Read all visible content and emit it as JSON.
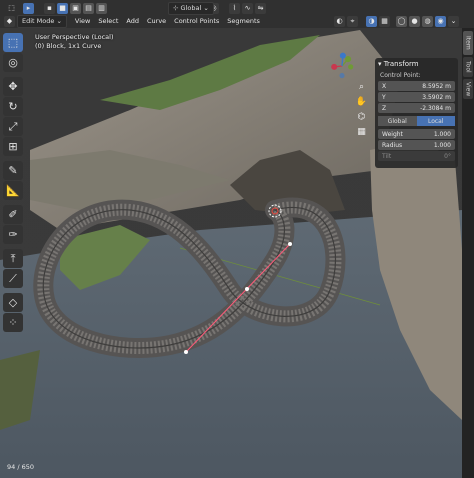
{
  "header": {
    "mode": "Edit Mode",
    "menus": [
      "View",
      "Select",
      "Add",
      "Curve",
      "Control Points",
      "Segments"
    ],
    "orientation": "Global"
  },
  "viewport": {
    "perspective": "User Perspective (Local)",
    "object": "(0) Block, 1x1 Curve",
    "frame_counter": "94 / 650"
  },
  "panel": {
    "title": "Transform",
    "control_point_label": "Control Point:",
    "x": {
      "label": "X",
      "value": "8.5952 m"
    },
    "y": {
      "label": "Y",
      "value": "3.5902 m"
    },
    "z": {
      "label": "Z",
      "value": "-2.3084 m"
    },
    "global_label": "Global",
    "local_label": "Local",
    "weight": {
      "label": "Weight",
      "value": "1.000"
    },
    "radius": {
      "label": "Radius",
      "value": "1.000"
    },
    "tilt": {
      "label": "Tilt",
      "value": "0°"
    }
  },
  "sidebar_tabs": [
    "Item",
    "Tool",
    "View"
  ],
  "gizmo": {
    "x": "X",
    "y": "Y",
    "z": "Z"
  }
}
